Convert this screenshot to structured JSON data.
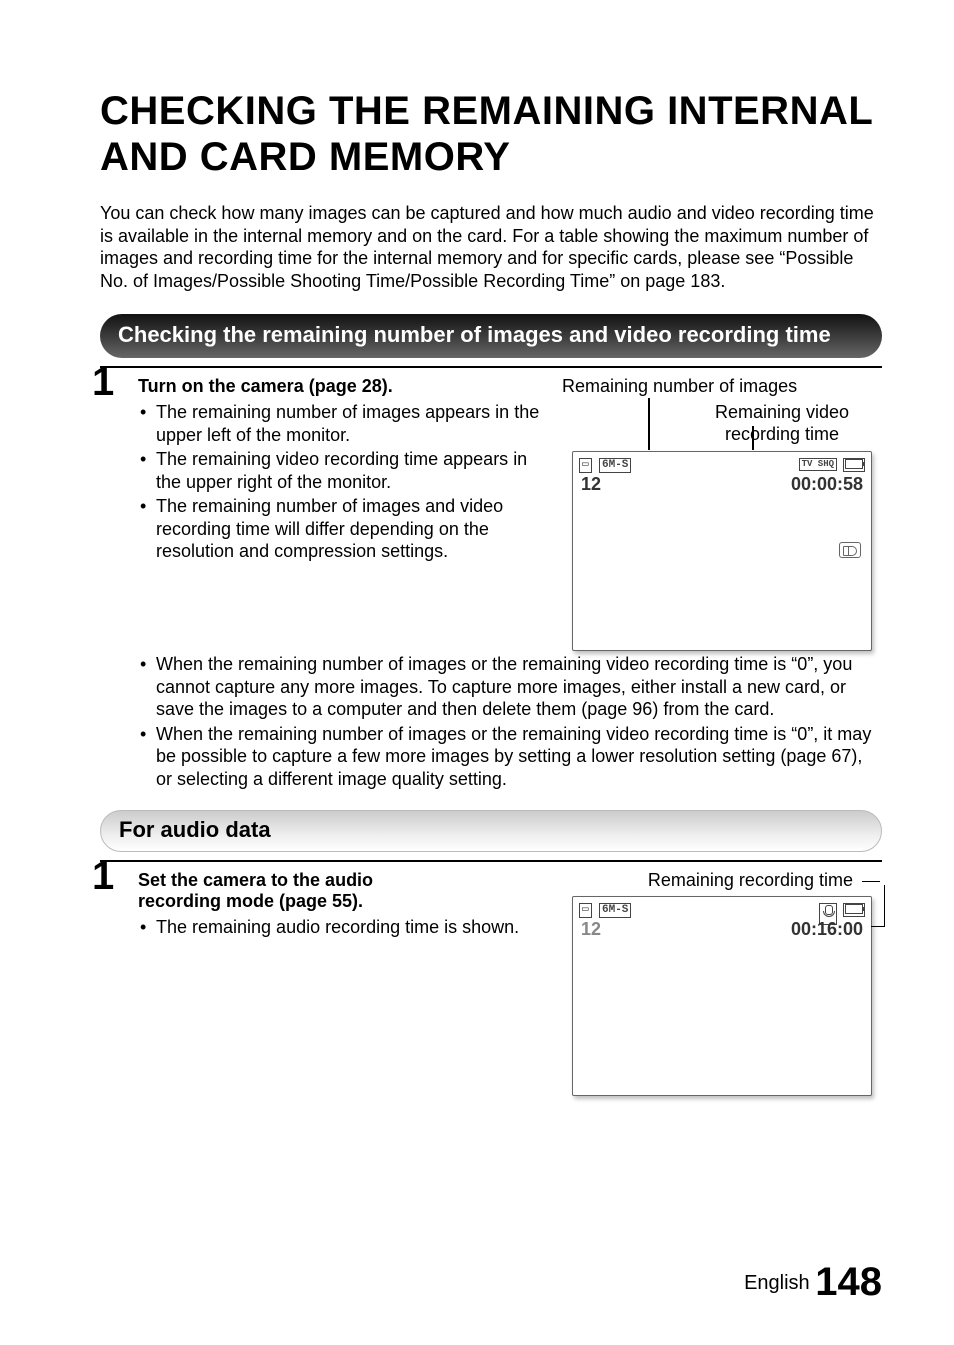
{
  "title": "CHECKING THE REMAINING INTERNAL AND CARD MEMORY",
  "intro": "You can check how many images can be captured and how much audio and video recording time is available in the internal memory and on the card. For a table showing the maximum number of images and recording time for the internal memory and for specific cards, please see “Possible No. of Images/Possible Shooting Time/Possible Recording Time” on page 183.",
  "section1": {
    "heading": "Checking the remaining number of images and video recording time",
    "step_num": "1",
    "step_title": "Turn on the camera (page 28).",
    "bullets": [
      "The remaining number of images appears in the upper left of the monitor.",
      "The remaining video recording time appears in the upper right of the monitor.",
      "The remaining number of images and video recording time will differ depending on the resolution and compression settings.",
      "When the remaining number of images or the remaining video recording time is “0”, you cannot capture any more images. To capture more images, either install a new card, or save the images to a computer and then delete them (page 96) from the card.",
      "When the remaining number of images or the remaining video recording time is “0”, it may be possible to capture a few more images by setting a lower resolution setting (page 67), or selecting a different image quality setting."
    ],
    "callout_images": "Remaining number of images",
    "callout_video_l1": "Remaining video",
    "callout_video_l2": "recording time",
    "screen": {
      "top_left_mode": "6M-S",
      "count": "12",
      "top_right_mode": "TV SHQ",
      "time": "00:00:58"
    }
  },
  "section2": {
    "heading": "For audio data",
    "step_num": "1",
    "step_title": "Set the camera to the audio recording mode (page 55).",
    "bullets": [
      "The remaining audio recording time is shown."
    ],
    "callout_audio": "Remaining recording time",
    "screen": {
      "top_left_mode": "6M-S",
      "count": "12",
      "time": "00:16:00"
    }
  },
  "footer": {
    "lang": "English",
    "page": "148"
  }
}
